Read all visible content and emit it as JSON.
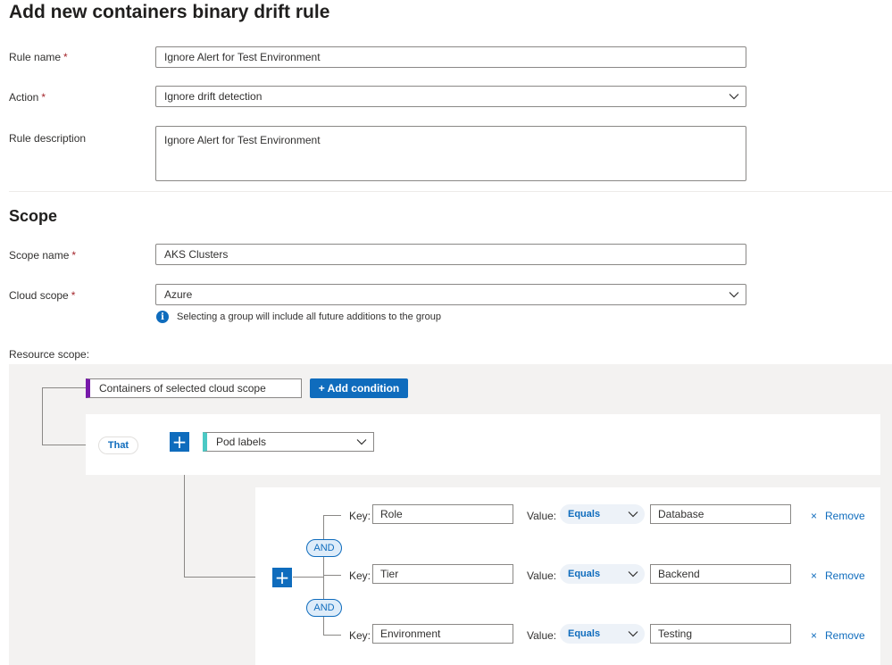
{
  "page": {
    "title": "Add new containers binary drift rule"
  },
  "rule": {
    "name_label": "Rule name",
    "name_value": "Ignore Alert for Test Environment",
    "action_label": "Action",
    "action_value": "Ignore drift detection",
    "description_label": "Rule description",
    "description_value": "Ignore Alert for Test Environment",
    "required_mark": "*"
  },
  "scope": {
    "heading": "Scope",
    "name_label": "Scope name",
    "name_value": "AKS Clusters",
    "cloud_label": "Cloud scope",
    "cloud_value": "Azure",
    "info_icon_glyph": "i",
    "info_text": "Selecting a group will include all future additions to the group",
    "resource_label": "Resource scope:"
  },
  "builder": {
    "root_value": "Containers of selected cloud scope",
    "add_condition_label": "+ Add condition",
    "that_label": "That",
    "plus_glyph": "+",
    "criteria_value": "Pod labels",
    "and_label": "AND",
    "key_label": "Key:",
    "value_label": "Value:",
    "remove_glyph": "×",
    "remove_label": "Remove",
    "conditions": [
      {
        "key": "Role",
        "operator": "Equals",
        "value": "Database"
      },
      {
        "key": "Tier",
        "operator": "Equals",
        "value": "Backend"
      },
      {
        "key": "Environment",
        "operator": "Equals",
        "value": "Testing"
      }
    ]
  },
  "icons": {
    "dropdown": "chevron-down-icon",
    "info": "info-icon",
    "add": "plus-icon",
    "remove": "close-icon"
  },
  "colors": {
    "accent": "#0f6cbd",
    "root_tag": "#7719aa",
    "criteria_tag": "#4bc9c5",
    "required": "#a4262c"
  }
}
